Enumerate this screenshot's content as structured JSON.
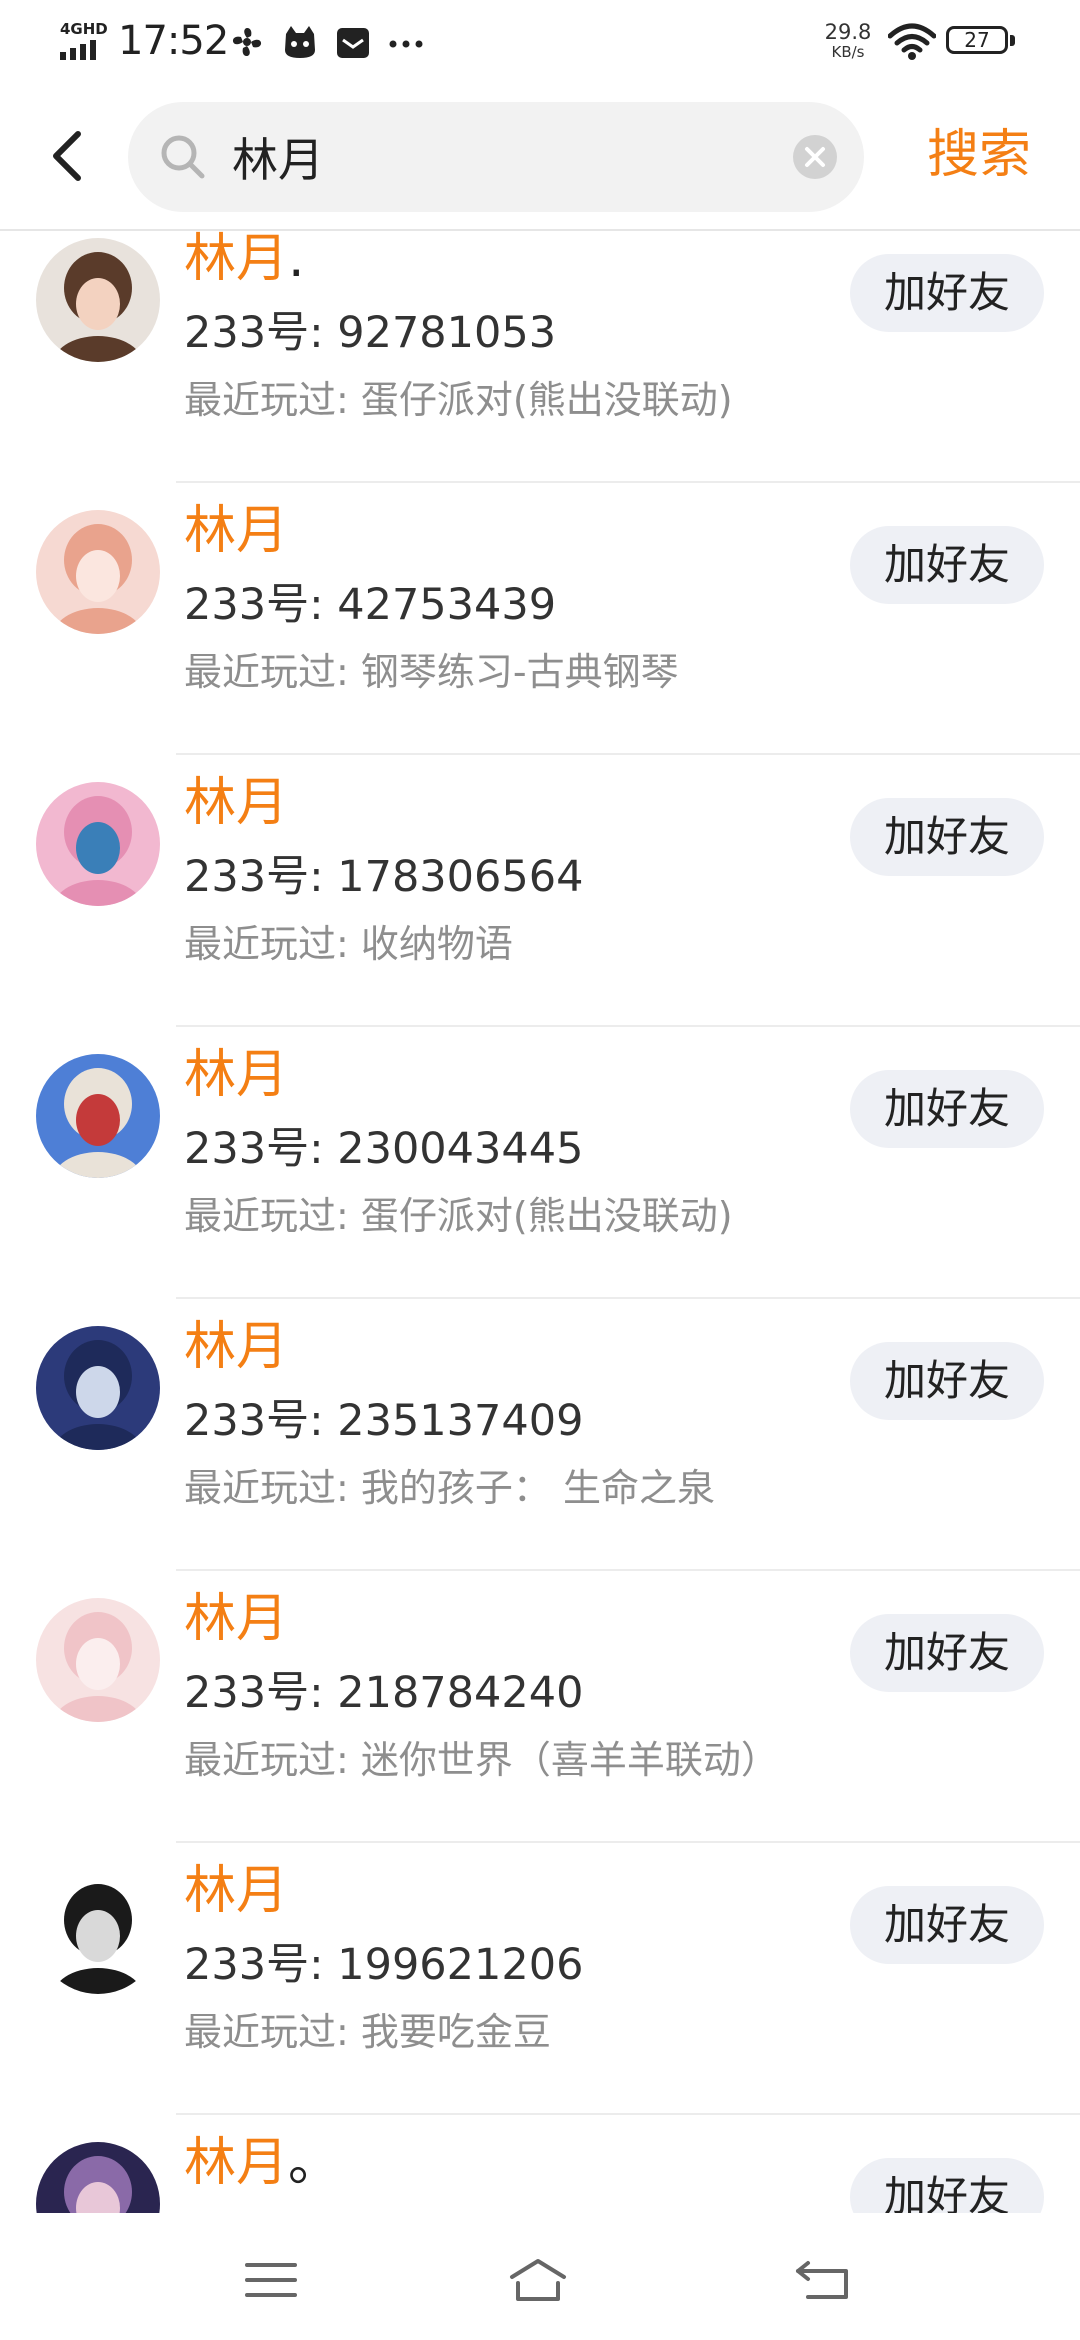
{
  "status_bar": {
    "network_type": "4GHD",
    "time": "17:52",
    "net_speed_value": "29.8",
    "net_speed_unit": "KB/s",
    "battery_level": "27",
    "app_icons": [
      "fan-icon",
      "cat-face-icon",
      "mail-icon",
      "more-dots-icon"
    ]
  },
  "search": {
    "query": "林月",
    "submit_label": "搜索"
  },
  "results": [
    {
      "name": "林月",
      "name_suffix": ".",
      "id_text": "233号: 92781053",
      "recent_text": "最近玩过: 蛋仔派对(熊出没联动)",
      "add_label": "加好友",
      "avatar_colors": [
        "#e8e2dc",
        "#5a3b2a",
        "#f3d2c0"
      ]
    },
    {
      "name": "林月",
      "name_suffix": "",
      "id_text": "233号: 42753439",
      "recent_text": "最近玩过: 钢琴练习-古典钢琴",
      "add_label": "加好友",
      "avatar_colors": [
        "#f6d9d2",
        "#e9a38d",
        "#fbe6df"
      ]
    },
    {
      "name": "林月",
      "name_suffix": "",
      "id_text": "233号: 178306564",
      "recent_text": "最近玩过: 收纳物语",
      "add_label": "加好友",
      "avatar_colors": [
        "#f2b8d0",
        "#e58fb3",
        "#3a7fb8"
      ]
    },
    {
      "name": "林月",
      "name_suffix": "",
      "id_text": "233号: 230043445",
      "recent_text": "最近玩过: 蛋仔派对(熊出没联动)",
      "add_label": "加好友",
      "avatar_colors": [
        "#4e7fd6",
        "#e9e2d8",
        "#c43a3a"
      ]
    },
    {
      "name": "林月",
      "name_suffix": "",
      "id_text": "233号: 235137409",
      "recent_text": "最近玩过: 我的孩子： 生命之泉",
      "add_label": "加好友",
      "avatar_colors": [
        "#2c3a7a",
        "#1e2a5a",
        "#cdd7ea"
      ]
    },
    {
      "name": "林月",
      "name_suffix": "",
      "id_text": "233号: 218784240",
      "recent_text": "最近玩过: 迷你世界（喜羊羊联动）",
      "add_label": "加好友",
      "avatar_colors": [
        "#f7e2e2",
        "#f0c4c8",
        "#fbeeee"
      ]
    },
    {
      "name": "林月",
      "name_suffix": "",
      "id_text": "233号: 199621206",
      "recent_text": "最近玩过: 我要吃金豆",
      "add_label": "加好友",
      "avatar_colors": [
        "#ffffff",
        "#1a1a1a",
        "#d9d9d9"
      ]
    },
    {
      "name": "林月",
      "name_suffix": "。",
      "id_text": "",
      "recent_text": "",
      "add_label": "加好友",
      "avatar_colors": [
        "#2a2550",
        "#8a6aa8",
        "#e8c7d8"
      ]
    }
  ],
  "navigation": {
    "buttons": [
      "menu-icon",
      "home-icon",
      "back-arrow-icon"
    ]
  },
  "colors": {
    "accent": "#f47f14",
    "button_bg": "#eef0f5",
    "secondary_text": "#8e8e8e"
  }
}
